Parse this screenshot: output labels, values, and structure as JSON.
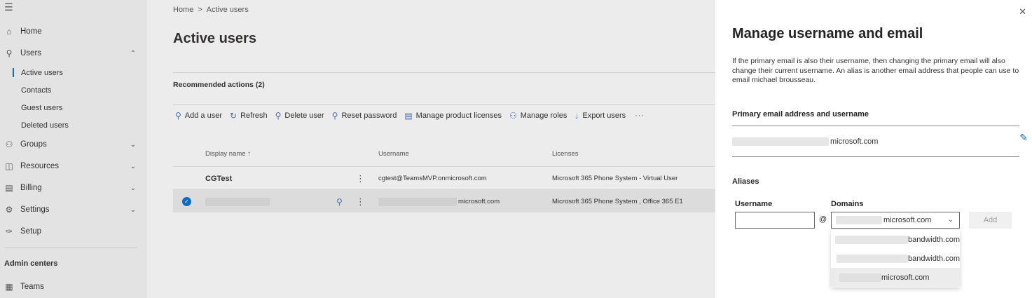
{
  "sidebar": {
    "items": [
      {
        "label": "Home",
        "icon": "home-icon"
      },
      {
        "label": "Users",
        "icon": "person-icon"
      },
      {
        "label": "Groups",
        "icon": "groups-icon"
      },
      {
        "label": "Resources",
        "icon": "resources-icon"
      },
      {
        "label": "Billing",
        "icon": "billing-icon"
      },
      {
        "label": "Settings",
        "icon": "gear-icon"
      },
      {
        "label": "Setup",
        "icon": "wrench-icon"
      }
    ],
    "users_subitems": [
      "Active users",
      "Contacts",
      "Guest users",
      "Deleted users"
    ],
    "admin_centers_heading": "Admin centers",
    "admin_centers": [
      {
        "label": "Teams",
        "icon": "teams-icon"
      }
    ]
  },
  "main": {
    "breadcrumb": [
      "Home",
      ">",
      "Active users"
    ],
    "title": "Active users",
    "recommended_actions": "Recommended actions (2)",
    "toolbar": [
      "Add a user",
      "Refresh",
      "Delete user",
      "Reset password",
      "Manage product licenses",
      "Manage roles",
      "Export users"
    ],
    "table": {
      "headers": {
        "display_name": "Display name ↑",
        "username": "Username",
        "licenses": "Licenses"
      },
      "rows": [
        {
          "display_name": "CGTest",
          "username": "cgtest@TeamsMVP.onmicrosoft.com",
          "licenses": "Microsoft 365 Phone System - Virtual User",
          "selected": false
        },
        {
          "display_name": "",
          "username": "microsoft.com",
          "licenses": "Microsoft 365 Phone System , Office 365 E1",
          "selected": true
        }
      ]
    }
  },
  "panel": {
    "title": "Manage username and email",
    "description": "If the primary email is also their username, then changing the primary email will also change their current username. An alias is another email address that people can use to email michael brousseau.",
    "primary_heading": "Primary email address and username",
    "primary_value": "microsoft.com",
    "aliases_heading": "Aliases",
    "username_label": "Username",
    "domains_label": "Domains",
    "username_value": "",
    "at_symbol": "@",
    "selected_domain": "microsoft.com",
    "add_label": "Add",
    "domain_options": [
      "bandwidth.com",
      "bandwidth.com",
      "microsoft.com"
    ]
  },
  "colors": {
    "accent": "#0f6cbd",
    "sidebar_bg": "#e3e3e3",
    "main_bg": "#ececec",
    "panel_bg": "#ffffff"
  }
}
